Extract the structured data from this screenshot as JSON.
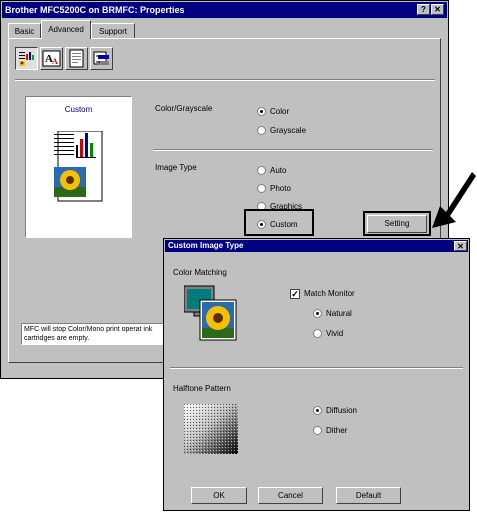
{
  "window": {
    "title": "Brother MFC5200C on BRMFC: Properties",
    "help_btn": "?",
    "close_btn": "✕"
  },
  "tabs": [
    {
      "label": "Basic"
    },
    {
      "label": "Advanced"
    },
    {
      "label": "Support"
    }
  ],
  "toolbar_icons": [
    "printer-quality-icon",
    "font-icon",
    "watermark-icon",
    "device-options-icon"
  ],
  "preview": {
    "label": "Custom"
  },
  "color_grayscale": {
    "label": "Color/Grayscale",
    "options": [
      "Color",
      "Grayscale"
    ],
    "selected": "Color"
  },
  "image_type": {
    "label": "Image Type",
    "options": [
      "Auto",
      "Photo",
      "Graphics",
      "Custom"
    ],
    "selected": "Custom",
    "setting_button": "Setting"
  },
  "status_text": "MFC will stop Color/Mono print operat ink cartridges are empty.",
  "dialog": {
    "title": "Custom Image Type",
    "close_btn": "✕",
    "color_matching": {
      "label": "Color Matching",
      "match_monitor": "Match Monitor",
      "match_monitor_checked": true,
      "options": [
        "Natural",
        "Vivid"
      ],
      "selected": "Natural"
    },
    "halftone": {
      "label": "Halftone Pattern",
      "options": [
        "Diffusion",
        "Dither"
      ],
      "selected": "Diffusion"
    },
    "buttons": {
      "ok": "OK",
      "cancel": "Cancel",
      "default": "Default"
    }
  }
}
